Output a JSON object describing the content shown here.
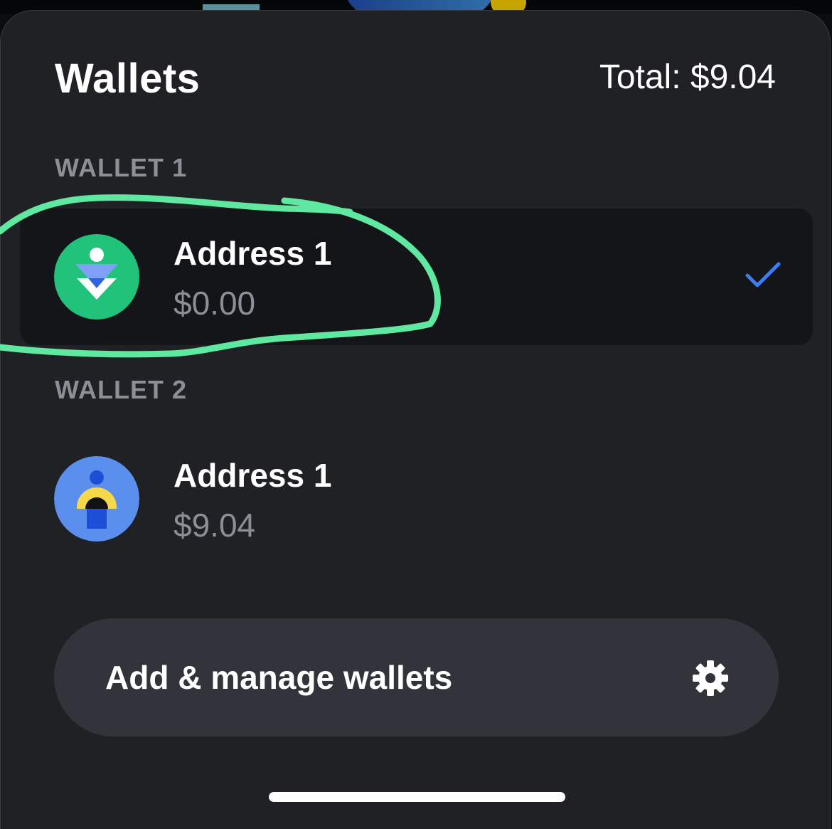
{
  "header": {
    "title": "Wallets",
    "total": "Total: $9.04"
  },
  "wallets": [
    {
      "section_label": "WALLET 1",
      "address_name": "Address 1",
      "balance": "$0.00",
      "selected": true,
      "avatar_icon": "green-wallet-avatar-icon",
      "avatar_color": "#21c27a"
    },
    {
      "section_label": "WALLET 2",
      "address_name": "Address 1",
      "balance": "$9.04",
      "selected": false,
      "avatar_icon": "blue-wallet-avatar-icon",
      "avatar_color": "#5b8fee"
    }
  ],
  "actions": {
    "manage_label": "Add & manage wallets",
    "manage_icon": "gear-icon"
  },
  "colors": {
    "sheet_background": "#202124",
    "selected_row": "#141518",
    "check_accent": "#3d7cf2",
    "muted_text": "#8b8f98",
    "annotation_stroke": "#5ee8a0"
  }
}
